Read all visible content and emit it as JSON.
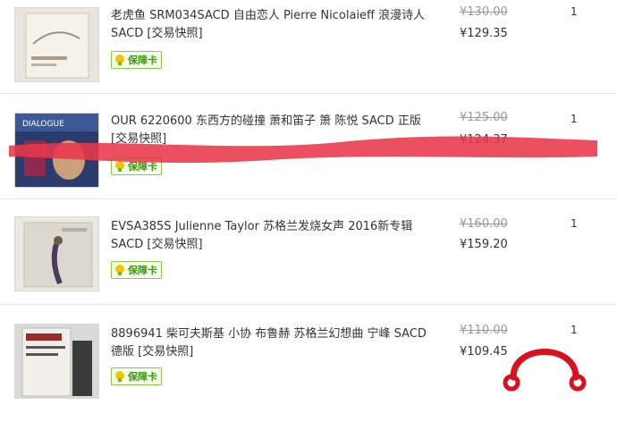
{
  "badge_label": "保障卡",
  "items": [
    {
      "title": "老虎鱼 SRM034SACD 自由恋人 Pierre Nicolaieff 浪漫诗人 SACD [交易快照]",
      "old_price": "¥130.00",
      "new_price": "¥129.35",
      "qty": "1"
    },
    {
      "title": "OUR 6220600 东西方的碰撞 萧和笛子 箫 陈悦 SACD 正版 [交易快照]",
      "old_price": "¥125.00",
      "new_price": "¥124.37",
      "qty": "1"
    },
    {
      "title": "EVSA385S Julienne Taylor 苏格兰发烧女声 2016新专辑 SACD [交易快照]",
      "old_price": "¥160.00",
      "new_price": "¥159.20",
      "qty": "1"
    },
    {
      "title": "8896941 柴可夫斯基 小协 布鲁赫 苏格兰幻想曲 宁峰 SACD 德版 [交易快照]",
      "old_price": "¥110.00",
      "new_price": "¥109.45",
      "qty": "1"
    }
  ]
}
